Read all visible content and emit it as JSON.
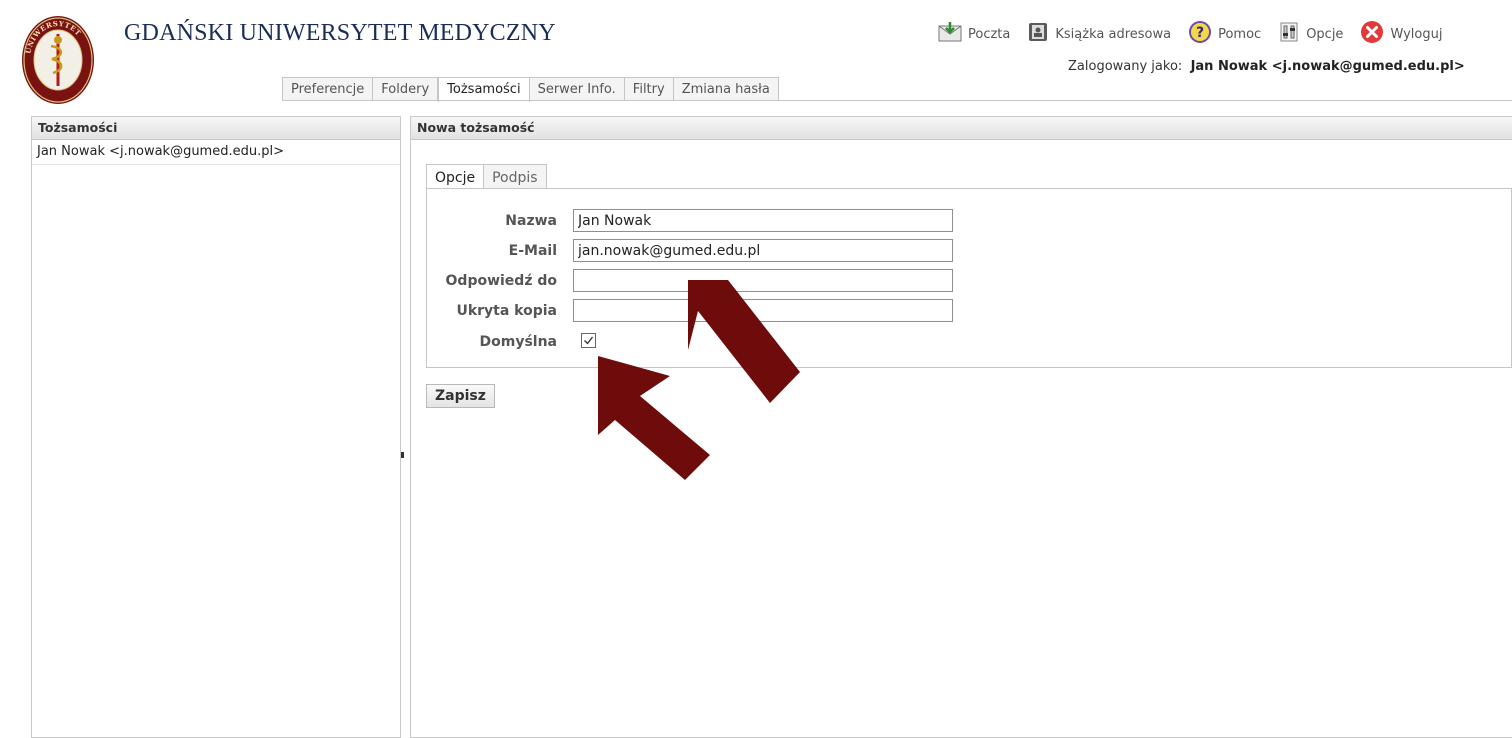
{
  "header": {
    "title": "GDAŃSKI UNIWERSYTET MEDYCZNY",
    "logo_text_top": "UNIWERSYTET",
    "logo_text_left": "GDAŃSKI",
    "logo_text_right": "MEDYCZNY"
  },
  "toolbar": {
    "items": [
      {
        "label": "Poczta",
        "icon": "mail-icon"
      },
      {
        "label": "Książka adresowa",
        "icon": "address-book-icon"
      },
      {
        "label": "Pomoc",
        "icon": "help-icon"
      },
      {
        "label": "Opcje",
        "icon": "options-icon"
      },
      {
        "label": "Wyloguj",
        "icon": "logout-icon"
      }
    ]
  },
  "login": {
    "prefix": "Zalogowany jako:",
    "user": "Jan Nowak <j.nowak@gumed.edu.pl>"
  },
  "tabs": [
    {
      "label": "Preferencje",
      "active": false
    },
    {
      "label": "Foldery",
      "active": false
    },
    {
      "label": "Tożsamości",
      "active": true
    },
    {
      "label": "Serwer Info.",
      "active": false
    },
    {
      "label": "Filtry",
      "active": false
    },
    {
      "label": "Zmiana hasła",
      "active": false
    }
  ],
  "identities_panel": {
    "title": "Tożsamości",
    "items": [
      "Jan Nowak <j.nowak@gumed.edu.pl>"
    ]
  },
  "new_identity_panel": {
    "title": "Nowa tożsamość",
    "subtabs": [
      {
        "label": "Opcje",
        "active": true
      },
      {
        "label": "Podpis",
        "active": false
      }
    ],
    "fields": {
      "name": {
        "label": "Nazwa",
        "value": "Jan Nowak"
      },
      "email": {
        "label": "E-Mail",
        "value": "jan.nowak@gumed.edu.pl"
      },
      "reply_to": {
        "label": "Odpowiedź do",
        "value": ""
      },
      "bcc": {
        "label": "Ukryta kopia",
        "value": ""
      },
      "default": {
        "label": "Domyślna",
        "checked": true
      }
    },
    "save_label": "Zapisz"
  },
  "colors": {
    "title": "#1a2d57",
    "arrow": "#6e0b0b"
  }
}
